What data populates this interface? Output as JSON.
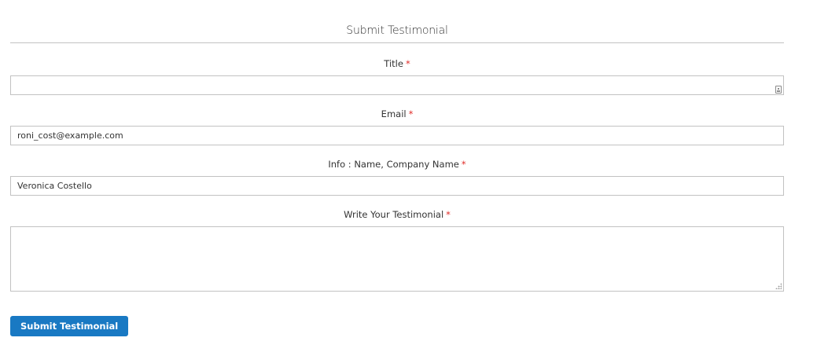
{
  "form": {
    "legend": "Submit Testimonial",
    "required_marker": "*",
    "fields": {
      "title": {
        "label": "Title",
        "value": ""
      },
      "email": {
        "label": "Email",
        "value": "roni_cost@example.com"
      },
      "info": {
        "label": "Info : Name, Company Name",
        "value": "Veronica Costello"
      },
      "testimonial": {
        "label": "Write Your Testimonial",
        "value": ""
      }
    },
    "submit_label": "Submit Testimonial"
  },
  "colors": {
    "required": "#e02b27",
    "button": "#1979c3",
    "border": "#c2c2c2"
  },
  "icons": {
    "title_field_icon": "contact-card-icon",
    "textarea_resize": "resize-handle-icon"
  }
}
